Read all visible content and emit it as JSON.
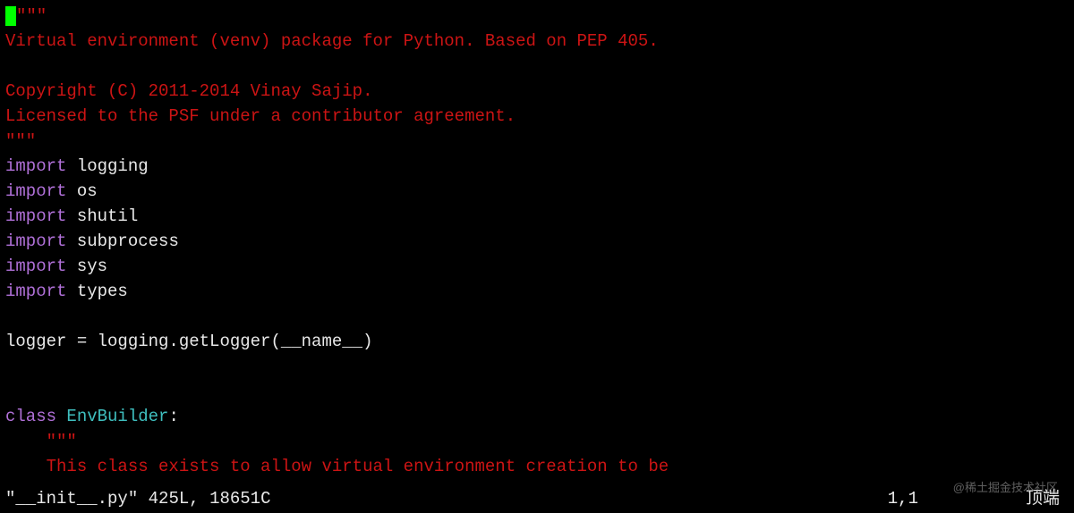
{
  "code": {
    "lines": [
      {
        "type": "first",
        "quote_open": "\"\"\""
      },
      {
        "type": "docstring",
        "text": "Virtual environment (venv) package for Python. Based on PEP 405."
      },
      {
        "type": "blank"
      },
      {
        "type": "docstring",
        "text": "Copyright (C) 2011-2014 Vinay Sajip."
      },
      {
        "type": "docstring",
        "text": "Licensed to the PSF under a contributor agreement."
      },
      {
        "type": "docstring",
        "text": "\"\"\""
      },
      {
        "type": "import",
        "keyword": "import",
        "module": "logging"
      },
      {
        "type": "import",
        "keyword": "import",
        "module": "os"
      },
      {
        "type": "import",
        "keyword": "import",
        "module": "shutil"
      },
      {
        "type": "import",
        "keyword": "import",
        "module": "subprocess"
      },
      {
        "type": "import",
        "keyword": "import",
        "module": "sys"
      },
      {
        "type": "import",
        "keyword": "import",
        "module": "types"
      },
      {
        "type": "blank"
      },
      {
        "type": "normal",
        "text": "logger = logging.getLogger(__name__)"
      },
      {
        "type": "blank"
      },
      {
        "type": "blank"
      },
      {
        "type": "class",
        "keyword": "class",
        "name": "EnvBuilder",
        "colon": ":"
      },
      {
        "type": "docstring_indent",
        "text": "    \"\"\""
      },
      {
        "type": "docstring_indent",
        "text": "    This class exists to allow virtual environment creation to be"
      }
    ]
  },
  "status": {
    "filename": "\"__init__.py\"",
    "lines": "425L,",
    "chars": "18651C",
    "position": "1,1",
    "scroll": "顶端"
  },
  "watermark": "@稀土掘金技术社区"
}
